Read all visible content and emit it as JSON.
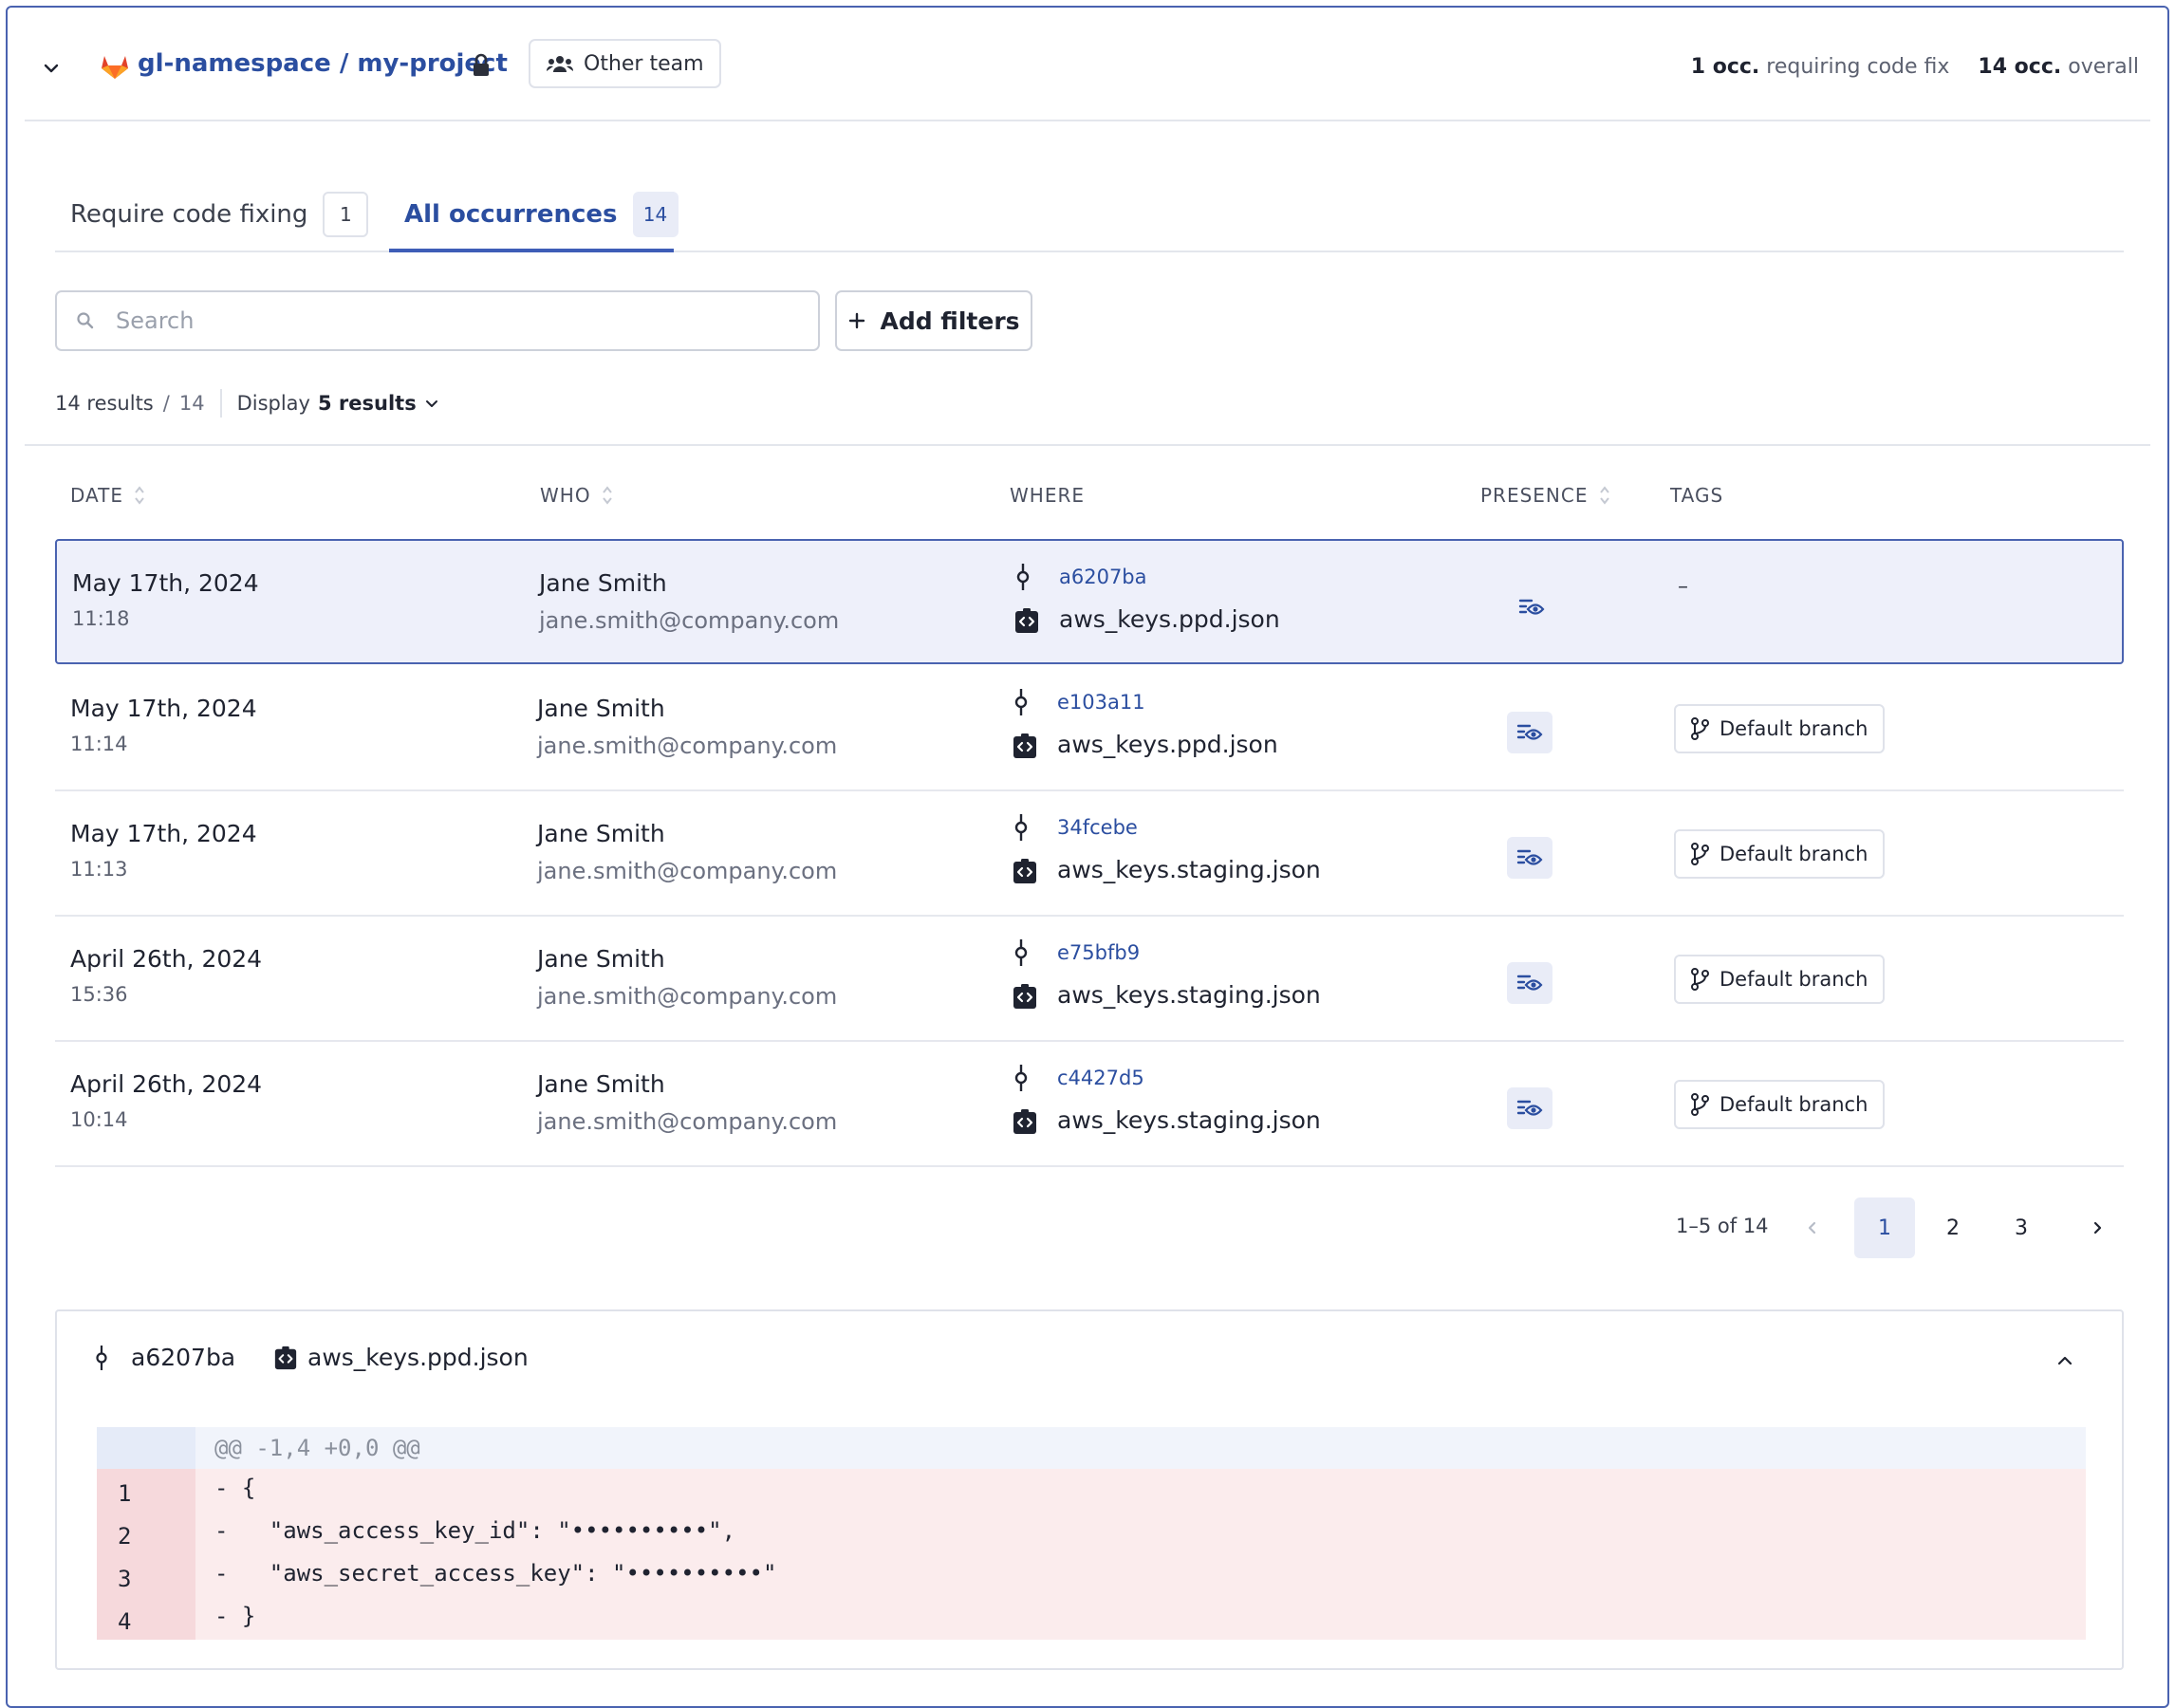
{
  "project": {
    "name": "gl-namespace / my-project",
    "team": "Other team",
    "occ_fix_count": "1 occ.",
    "occ_fix_label": "requiring code fix",
    "occ_total_count": "14 occ.",
    "occ_total_label": "overall"
  },
  "tabs": [
    {
      "label": "Require code fixing",
      "count": "1"
    },
    {
      "label": "All occurrences",
      "count": "14"
    }
  ],
  "search": {
    "placeholder": "Search"
  },
  "filters": {
    "add_label": "Add filters"
  },
  "results": {
    "count": "14 results",
    "slash": "/",
    "total": "14",
    "display_label": "Display",
    "display_value": "5 results"
  },
  "table": {
    "headers": {
      "date": "DATE",
      "who": "WHO",
      "where": "WHERE",
      "presence": "PRESENCE",
      "tags": "TAGS"
    },
    "rows": [
      {
        "date": "May 17th, 2024",
        "time": "11:18",
        "name": "Jane Smith",
        "email": "jane.smith@company.com",
        "commit": "a6207ba",
        "file": "aws_keys.ppd.json",
        "tag": "–"
      },
      {
        "date": "May 17th, 2024",
        "time": "11:14",
        "name": "Jane Smith",
        "email": "jane.smith@company.com",
        "commit": "e103a11",
        "file": "aws_keys.ppd.json",
        "tag": "Default branch"
      },
      {
        "date": "May 17th, 2024",
        "time": "11:13",
        "name": "Jane Smith",
        "email": "jane.smith@company.com",
        "commit": "34fcebe",
        "file": "aws_keys.staging.json",
        "tag": "Default branch"
      },
      {
        "date": "April 26th, 2024",
        "time": "15:36",
        "name": "Jane Smith",
        "email": "jane.smith@company.com",
        "commit": "e75bfb9",
        "file": "aws_keys.staging.json",
        "tag": "Default branch"
      },
      {
        "date": "April 26th, 2024",
        "time": "10:14",
        "name": "Jane Smith",
        "email": "jane.smith@company.com",
        "commit": "c4427d5",
        "file": "aws_keys.staging.json",
        "tag": "Default branch"
      }
    ]
  },
  "pagination": {
    "range": "1–5 of 14",
    "pages": [
      "1",
      "2",
      "3"
    ],
    "current": "1"
  },
  "diff": {
    "commit": "a6207ba",
    "file": "aws_keys.ppd.json",
    "hunk": "@@ -1,4 +0,0 @@",
    "lines": [
      {
        "num": "1",
        "text": "- {"
      },
      {
        "num": "2",
        "text": "-   \"aws_access_key_id\": \"••••••••••\","
      },
      {
        "num": "3",
        "text": "-   \"aws_secret_access_key\": \"••••••••••\""
      },
      {
        "num": "4",
        "text": "- }"
      }
    ]
  },
  "colors": {
    "accent": "#2b4ea0",
    "selected_row_bg": "#eef0fa",
    "removed_line_bg": "#fbeced",
    "gitlab_orange": "#e2432a"
  },
  "icons": {
    "toggle": "chevron-down-icon",
    "logo": "gitlab-logo-icon",
    "lock": "lock-icon",
    "team": "team-icon",
    "search": "search-icon",
    "add": "plus-icon",
    "display": "chevron-down-icon",
    "sort": "sort-icon",
    "commit": "commit-icon",
    "file": "file-code-icon",
    "presence": "presence-eye-icon",
    "branch": "branch-icon",
    "prev": "chevron-left-icon",
    "next": "chevron-right-icon",
    "collapse": "chevron-up-icon"
  }
}
